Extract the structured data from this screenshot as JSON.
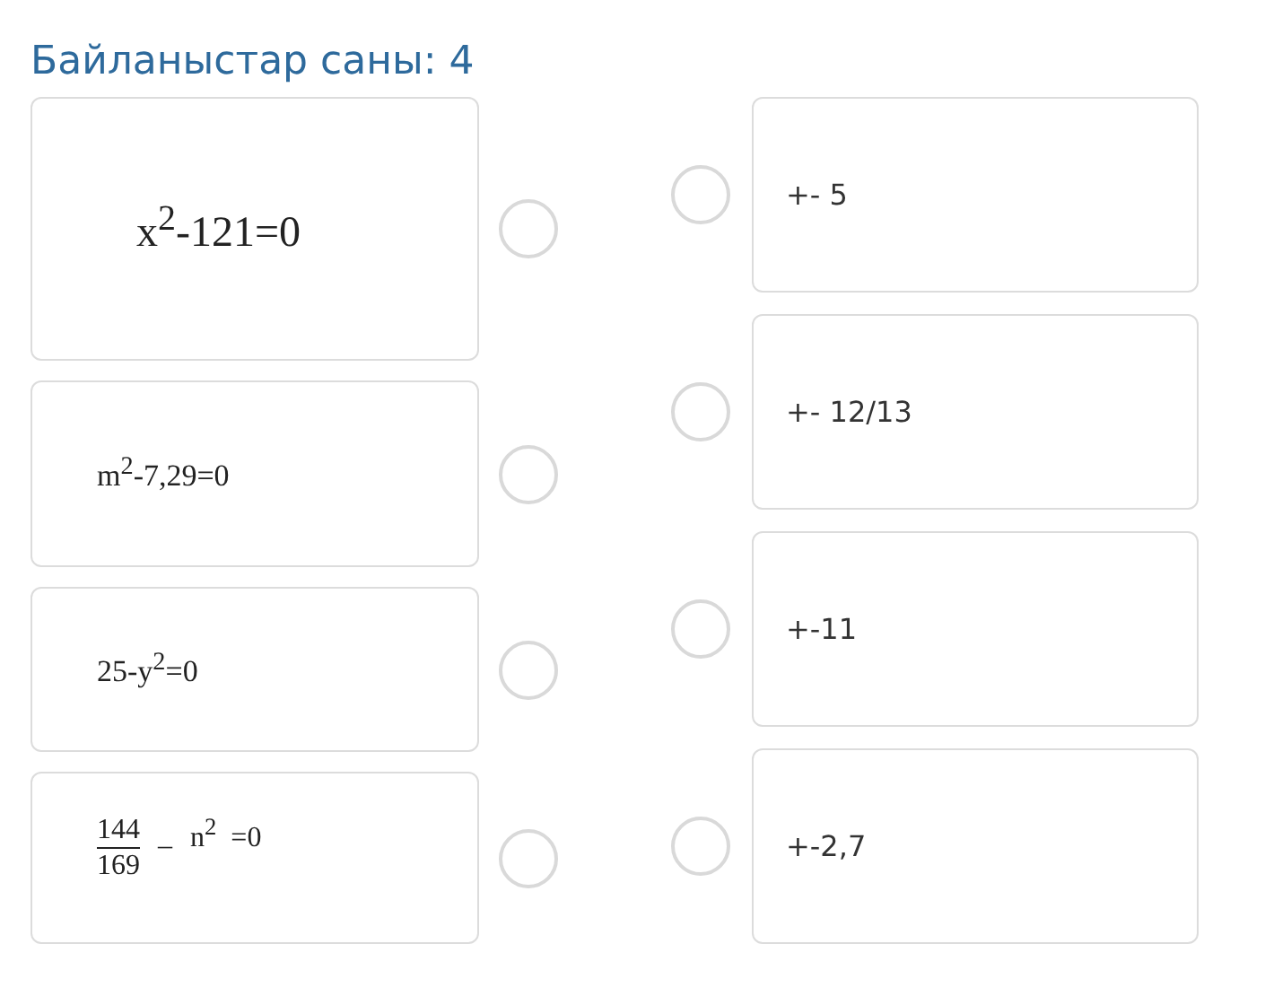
{
  "title": "Байланыстар саны: 4",
  "left": [
    {
      "kind": "formula",
      "text": "x$^{2}$-121=0",
      "selected": false
    },
    {
      "kind": "formula",
      "text": "m$^{2}$-7,29=0",
      "selected": false
    },
    {
      "kind": "formula",
      "text": "25-y$^{2}$=0",
      "selected": false
    },
    {
      "kind": "fraction",
      "numerator": "144",
      "denominator": "169",
      "minus": "–",
      "text": "n$^{2}$  =0",
      "selected": false
    }
  ],
  "right": [
    {
      "text": "+- 5",
      "selected": false
    },
    {
      "text": "+- 12/13",
      "selected": false
    },
    {
      "text": "+-11",
      "selected": false
    },
    {
      "text": "+-2,7",
      "selected": false
    }
  ]
}
